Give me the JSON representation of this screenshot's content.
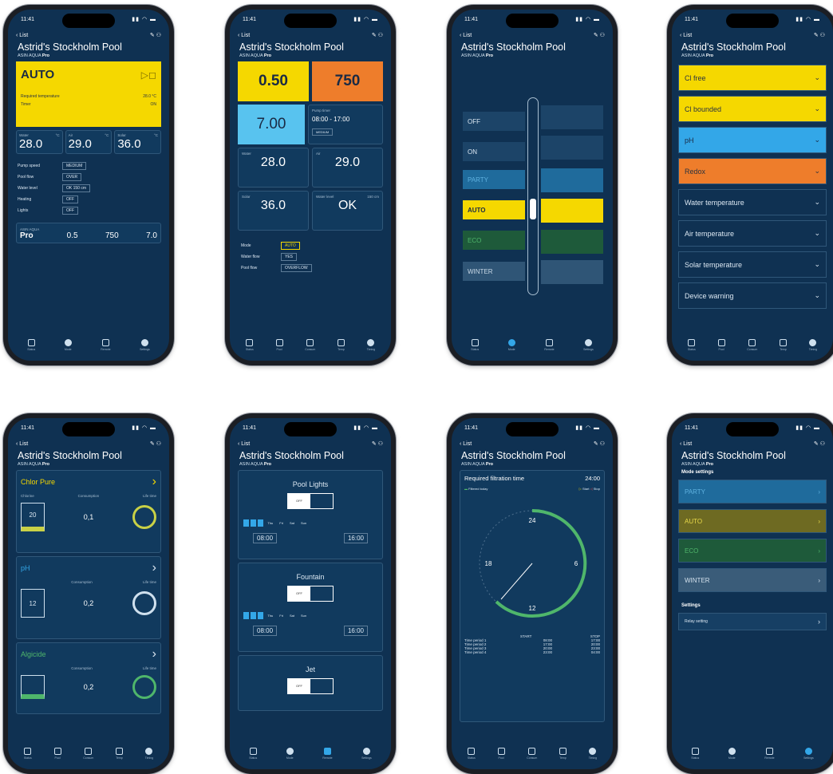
{
  "common": {
    "time": "11:41",
    "back": "List",
    "pool_name": "Astrid's Stockholm Pool",
    "device_prefix": "ASIN AQUA ",
    "device_model": "Pro",
    "tabs": [
      "Status",
      "Mode",
      "Remote",
      "Settings"
    ],
    "tabs_alt": [
      "Status",
      "Pool",
      "Consum",
      "Temp",
      "Timing"
    ]
  },
  "p1": {
    "mode": "AUTO",
    "req_label": "Required temperature",
    "req_value": "28.0 °C",
    "timer_label": "Timer",
    "timer_value": "ON",
    "water_label": "Water",
    "air_label": "Air",
    "solar_label": "Solar",
    "unit": "°C",
    "water": "28.0",
    "air": "29.0",
    "solar": "36.0",
    "rows": [
      [
        "Pump speed",
        "MEDIUM"
      ],
      [
        "Pool flow",
        "OVER"
      ],
      [
        "Water level",
        "OK 150 cm"
      ],
      [
        "Heating",
        "OFF"
      ],
      [
        "Lights",
        "OFF"
      ]
    ],
    "foot_device": "ASIN AQUA",
    "foot_model": "Pro",
    "foot_v1": "0.5",
    "foot_v2": "750",
    "foot_v3": "7.0"
  },
  "p2": {
    "cl_value": "0.50",
    "redox_value": "750",
    "ph_value": "7.00",
    "pump_timer_label": "Pump timer",
    "pump_timer_value": "08:00 - 17:00",
    "pump_speed": "MEDIUM",
    "water_label": "Water",
    "water_value": "28.0",
    "air_label": "Air",
    "air_value": "29.0",
    "solar_label": "Solar",
    "solar_value": "36.0",
    "level_label": "Water level",
    "level_unit": "150 cm",
    "level_value": "OK",
    "mode_label": "Mode",
    "mode_value": "AUTO",
    "flow_label": "Water flow",
    "flow_value": "YES",
    "pool_label": "Pool flow",
    "pool_value": "OVERFLOW"
  },
  "p3": {
    "modes": [
      "OFF",
      "ON",
      "PARTY",
      "AUTO",
      "ECO",
      "WINTER"
    ]
  },
  "p4": {
    "items": [
      "Cl free",
      "Cl bounded",
      "pH",
      "Redox",
      "Water temperature",
      "Air temperature",
      "Solar temperature",
      "Device warning"
    ]
  },
  "p5": {
    "sections": [
      {
        "title": "Chlor Pure",
        "value": "20",
        "consumption": "0,1"
      },
      {
        "title": "pH",
        "value": "12",
        "consumption": "0,2"
      },
      {
        "title": "Algicide",
        "value": "",
        "consumption": "0,2"
      }
    ],
    "col1": "Chlorine",
    "col2": "Consumption",
    "col3": "Life time"
  },
  "p6": {
    "items": [
      {
        "title": "Pool Lights",
        "from": "08:00",
        "to": "16:00"
      },
      {
        "title": "Fountain",
        "from": "08:00",
        "to": "16:00"
      },
      {
        "title": "Jet",
        "from": "",
        "to": ""
      }
    ],
    "off": "OFF",
    "days": [
      "Thu",
      "Fri",
      "Sat",
      "Sun"
    ]
  },
  "p7": {
    "title": "Required filtration time",
    "hours": "24:00",
    "legend_today": "Filtered today",
    "legend_start": "Start",
    "legend_stop": "Stop",
    "start": "START",
    "stop": "STOP",
    "periods": [
      [
        "Time period 1",
        "08:00",
        "17:00"
      ],
      [
        "Time period 2",
        "17:00",
        "20:00"
      ],
      [
        "Time period 3",
        "20:00",
        "23:00"
      ],
      [
        "Time period 4",
        "23:00",
        "04:00"
      ]
    ],
    "dial": [
      "24",
      "6",
      "12",
      "18"
    ]
  },
  "p8": {
    "mode_settings": "Mode settings",
    "modes": [
      "PARTY",
      "AUTO",
      "ECO",
      "WINTER"
    ],
    "settings": "Settings",
    "relay": "Relay setting"
  }
}
